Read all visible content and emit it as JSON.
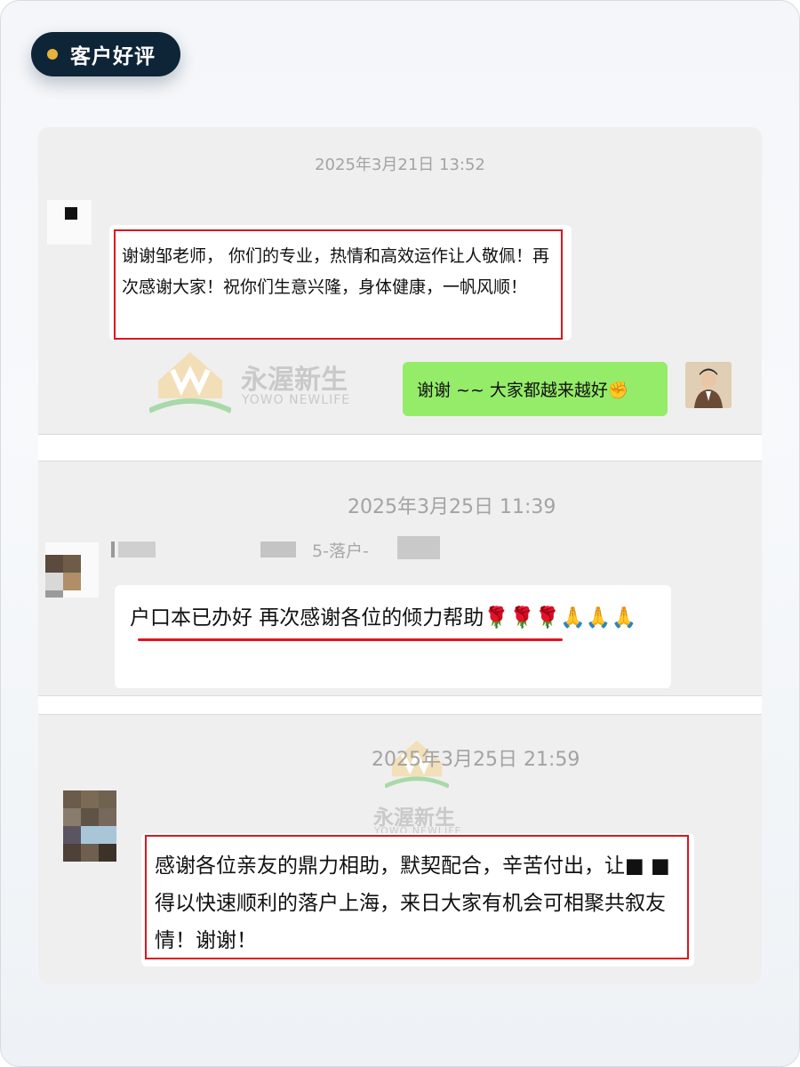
{
  "badge": {
    "label": "客户好评",
    "dot_color": "#e9b23a",
    "bg_color": "#0e2538"
  },
  "watermark": {
    "brand_cn": "永渥新生",
    "brand_en": "YOWO NEWLIFE"
  },
  "conversations": [
    {
      "timestamp": "2025年3月21日 13:52",
      "incoming_message": "谢谢邹老师，        你们的专业，热情和高效运作让人敬佩！再次感谢大家！祝你们生意兴隆，身体健康，一帆风顺！",
      "reply_message": "谢谢 ~~ 大家都越来越好✊"
    },
    {
      "timestamp": "2025年3月25日 11:39",
      "sender_name": "5-落户-",
      "incoming_message": "户口本已办好 再次感谢各位的倾力帮助🌹🌹🌹🙏🙏🙏"
    },
    {
      "timestamp": "2025年3月25日 21:59",
      "incoming_message": "感谢各位亲友的鼎力相助，默契配合，辛苦付出，让■ ■得以快速顺利的落户上海，来日大家有机会可相聚共叙友情！谢谢！"
    }
  ],
  "colors": {
    "highlight_red": "#e0141e",
    "reply_green": "#95ec69"
  }
}
